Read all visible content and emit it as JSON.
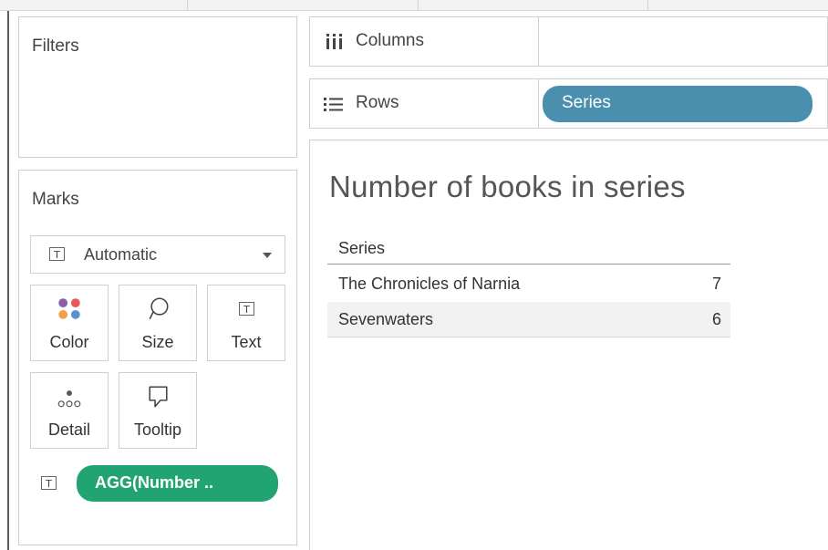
{
  "filters": {
    "title": "Filters"
  },
  "marks": {
    "title": "Marks",
    "mark_type": "Automatic",
    "cards": [
      {
        "label": "Color",
        "icon": "color-dots-icon"
      },
      {
        "label": "Size",
        "icon": "size-lasso-icon"
      },
      {
        "label": "Text",
        "icon": "text-t-icon"
      },
      {
        "label": "Detail",
        "icon": "detail-dots-icon"
      },
      {
        "label": "Tooltip",
        "icon": "tooltip-bubble-icon"
      }
    ],
    "field_pill": "AGG(Number ..",
    "t_glyph": "T"
  },
  "shelves": {
    "columns_label": "Columns",
    "rows_label": "Rows",
    "rows_pill": "Series"
  },
  "view": {
    "title": "Number of books in series",
    "header": "Series",
    "rows": [
      {
        "series": "The Chronicles of Narnia",
        "value": "7"
      },
      {
        "series": "Sevenwaters",
        "value": "6"
      }
    ]
  },
  "colors": {
    "green_pill": "#22a472",
    "blue_pill": "#4b8fae",
    "color_dots": [
      "#8a5ea8",
      "#e8595a",
      "#f2a04a",
      "#5a8fd0"
    ]
  }
}
